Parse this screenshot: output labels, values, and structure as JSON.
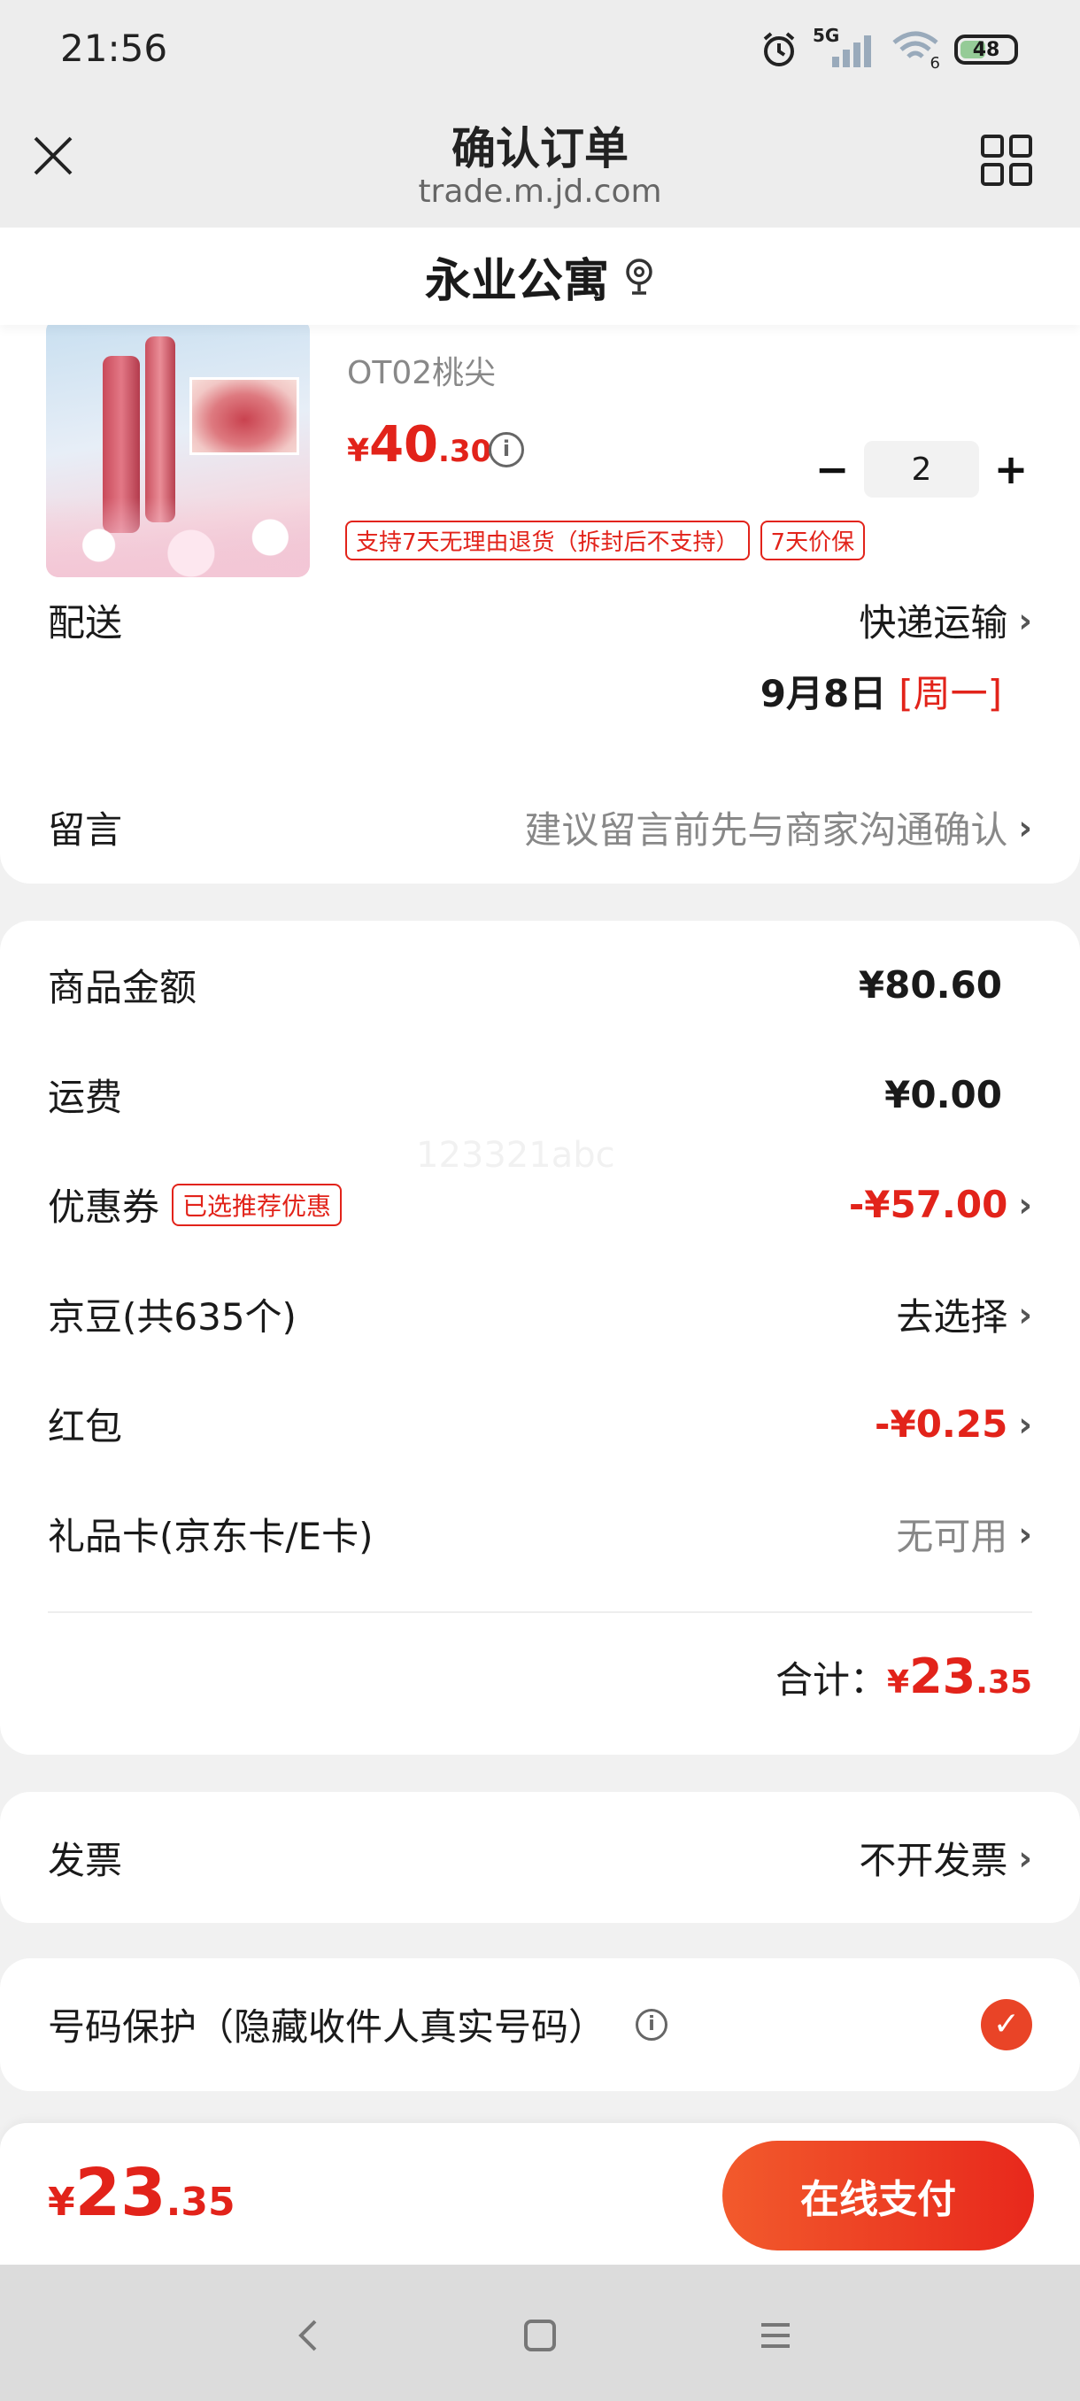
{
  "status_bar": {
    "time": "21:56",
    "signal_label": "5G",
    "wifi_label": "6",
    "battery": "48"
  },
  "header": {
    "title": "确认订单",
    "url": "trade.m.jd.com"
  },
  "address": {
    "name": "永业公寓"
  },
  "product": {
    "variant": "OT02桃尖",
    "price_yen": "¥",
    "price_int": "40",
    "price_dec": ".30",
    "quantity": "2",
    "tags": [
      "支持7天无理由退货（拆封后不支持）",
      "7天价保"
    ]
  },
  "delivery": {
    "label": "配送",
    "method": "快递运输",
    "date": "9月8日",
    "weekday": "[周一]"
  },
  "message": {
    "label": "留言",
    "placeholder": "建议留言前先与商家沟通确认"
  },
  "costs": {
    "goods_label": "商品金额",
    "goods_value": "¥80.60",
    "shipping_label": "运费",
    "shipping_value": "¥0.00",
    "coupon_label": "优惠券",
    "coupon_chip": "已选推荐优惠",
    "coupon_value": "-¥57.00",
    "beans_label": "京豆(共635个)",
    "beans_value": "去选择",
    "redpacket_label": "红包",
    "redpacket_value": "-¥0.25",
    "giftcard_label": "礼品卡(京东卡/E卡)",
    "giftcard_value": "无可用",
    "total_label": "合计：",
    "total_yen": "¥",
    "total_int": "23",
    "total_dec": ".35"
  },
  "watermark": "123321abc",
  "invoice": {
    "label": "发票",
    "value": "不开发票"
  },
  "privacy": {
    "label": "号码保护（隐藏收件人真实号码）",
    "checked": true
  },
  "pay": {
    "yen": "¥",
    "int": "23",
    "dec": ".35",
    "button": "在线支付"
  },
  "colors": {
    "accent_red": "#e2231a",
    "button_gradient_start": "#f25a2c",
    "button_gradient_end": "#e8281c"
  }
}
